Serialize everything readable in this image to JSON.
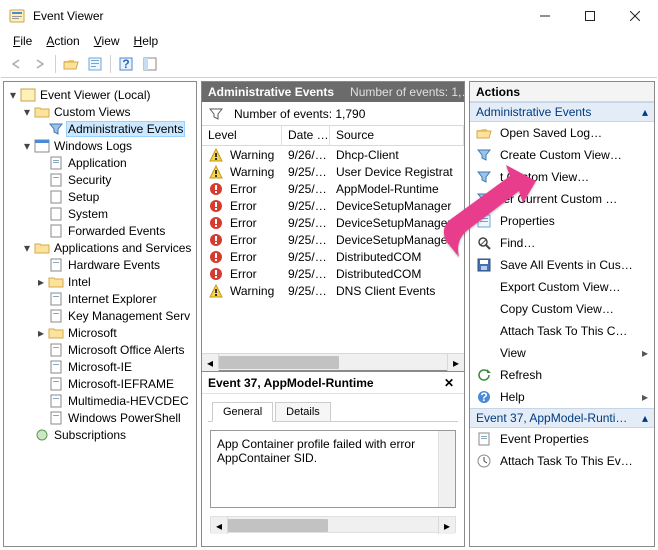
{
  "window": {
    "title": "Event Viewer"
  },
  "menu": [
    {
      "label": "File",
      "hotkey": "F"
    },
    {
      "label": "Action",
      "hotkey": "A"
    },
    {
      "label": "View",
      "hotkey": "V"
    },
    {
      "label": "Help",
      "hotkey": "H"
    }
  ],
  "tree": {
    "root": "Event Viewer (Local)",
    "custom_views": "Custom Views",
    "admin_events": "Administrative Events",
    "windows_logs": "Windows Logs",
    "wl": {
      "app": "Application",
      "sec": "Security",
      "setup": "Setup",
      "sys": "System",
      "fwd": "Forwarded Events"
    },
    "apps_services": "Applications and Services",
    "as": [
      "Hardware Events",
      "Intel",
      "Internet Explorer",
      "Key Management Serv",
      "Microsoft",
      "Microsoft Office Alerts",
      "Microsoft-IE",
      "Microsoft-IEFRAME",
      "Multimedia-HEVCDEC",
      "Windows PowerShell"
    ],
    "subs": "Subscriptions"
  },
  "center": {
    "header_title": "Administrative Events",
    "header_sub": "Number of events: 1,…",
    "count_label": "Number of events: 1,790",
    "columns": [
      "Level",
      "Date …",
      "Source"
    ],
    "rows": [
      {
        "level": "Warning",
        "date": "9/26/…",
        "source": "Dhcp-Client"
      },
      {
        "level": "Warning",
        "date": "9/25/…",
        "source": "User Device Registrat"
      },
      {
        "level": "Error",
        "date": "9/25/…",
        "source": "AppModel-Runtime"
      },
      {
        "level": "Error",
        "date": "9/25/…",
        "source": "DeviceSetupManager"
      },
      {
        "level": "Error",
        "date": "9/25/…",
        "source": "DeviceSetupManager"
      },
      {
        "level": "Error",
        "date": "9/25/…",
        "source": "DeviceSetupManager"
      },
      {
        "level": "Error",
        "date": "9/25/…",
        "source": "DistributedCOM"
      },
      {
        "level": "Error",
        "date": "9/25/…",
        "source": "DistributedCOM"
      },
      {
        "level": "Warning",
        "date": "9/25/…",
        "source": "DNS Client Events"
      }
    ]
  },
  "detail": {
    "title": "Event 37, AppModel-Runtime",
    "tabs": {
      "general": "General",
      "details": "Details"
    },
    "message": "App Container profile failed with error\nAppContainer SID."
  },
  "actions": {
    "header": "Actions",
    "section1": "Administrative Events",
    "items1": [
      {
        "label": "Open Saved Log…",
        "icon": "folder-open-icon"
      },
      {
        "label": "Create Custom View…",
        "icon": "funnel-icon"
      },
      {
        "label": "t Custom View…",
        "icon": "funnel-import-icon"
      },
      {
        "label": "ter Current Custom …",
        "icon": "funnel-filter-icon"
      },
      {
        "label": "Properties",
        "icon": "properties-icon"
      },
      {
        "label": "Find…",
        "icon": "find-icon"
      },
      {
        "label": "Save All Events in Cus…",
        "icon": "save-icon"
      },
      {
        "label": "Export Custom View…",
        "icon": "blank-icon"
      },
      {
        "label": "Copy Custom View…",
        "icon": "blank-icon"
      },
      {
        "label": "Attach Task To This C…",
        "icon": "blank-icon"
      },
      {
        "label": "View",
        "icon": "blank-icon",
        "submenu": true
      },
      {
        "label": "Refresh",
        "icon": "refresh-icon"
      },
      {
        "label": "Help",
        "icon": "help-icon",
        "submenu": true
      }
    ],
    "section2": "Event 37, AppModel-Runti…",
    "items2": [
      {
        "label": "Event Properties",
        "icon": "event-props-icon"
      },
      {
        "label": "Attach Task To This Ev…",
        "icon": "attach-task-icon"
      }
    ]
  },
  "colors": {
    "accent_blue": "#0078d7",
    "section_bg": "#e3ecf7",
    "hint_pink": "#e83e8c"
  }
}
